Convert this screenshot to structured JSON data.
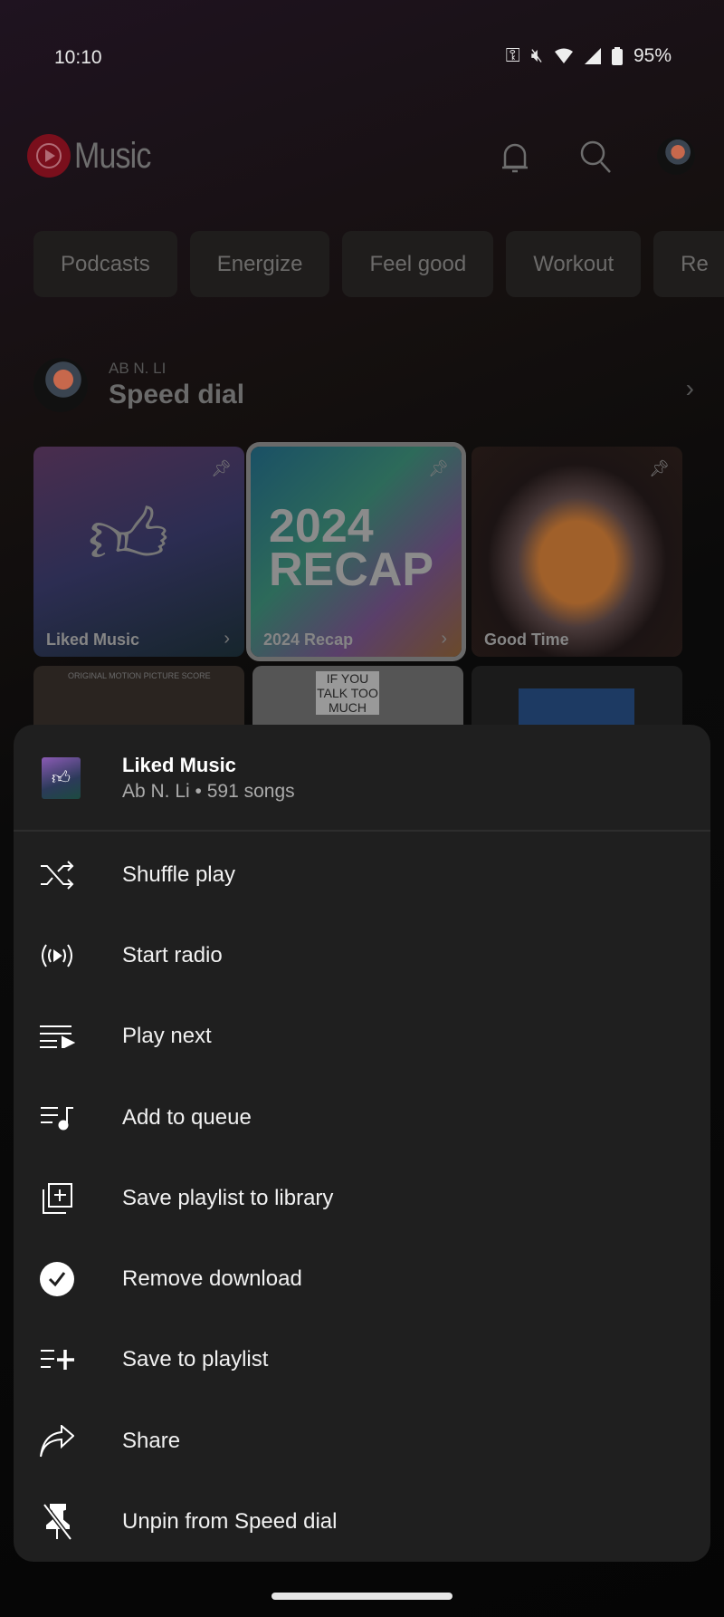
{
  "status_bar": {
    "time": "10:10",
    "battery": "95%"
  },
  "app": {
    "logo_text": "Music",
    "accent": "#ff0033"
  },
  "chips": [
    "Podcasts",
    "Energize",
    "Feel good",
    "Workout",
    "Re"
  ],
  "speed_dial": {
    "owner": "AB N. LI",
    "title": "Speed dial",
    "tiles": [
      {
        "label": "Liked Music"
      },
      {
        "label": "2024 Recap",
        "art_text": "2024 RECAP"
      },
      {
        "label": "Good Time"
      }
    ],
    "row2_texts": [
      "ORIGINAL MOTION PICTURE SCORE",
      "IF YOU TALK TOO MUCH"
    ]
  },
  "sheet": {
    "title": "Liked Music",
    "subtitle": "Ab N. Li • 591 songs",
    "items": [
      {
        "label": "Shuffle play",
        "icon": "shuffle-icon"
      },
      {
        "label": "Start radio",
        "icon": "radio-icon"
      },
      {
        "label": "Play next",
        "icon": "play-next-icon"
      },
      {
        "label": "Add to queue",
        "icon": "queue-music-icon"
      },
      {
        "label": "Save playlist to library",
        "icon": "library-add-icon"
      },
      {
        "label": "Remove download",
        "icon": "download-done-icon"
      },
      {
        "label": "Save to playlist",
        "icon": "playlist-add-icon"
      },
      {
        "label": "Share",
        "icon": "share-icon"
      },
      {
        "label": "Unpin from Speed dial",
        "icon": "unpin-icon"
      }
    ]
  }
}
